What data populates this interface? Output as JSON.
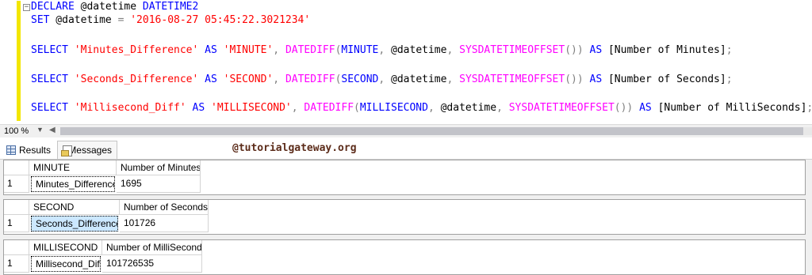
{
  "editor": {
    "collapse_glyph": "−",
    "lines": [
      [
        {
          "t": "DECLARE",
          "c": "kw"
        },
        {
          "t": " @datetime ",
          "c": "id"
        },
        {
          "t": "DATETIME2",
          "c": "dt"
        }
      ],
      [
        {
          "t": "SET",
          "c": "kw"
        },
        {
          "t": " @datetime ",
          "c": "id"
        },
        {
          "t": "=",
          "c": "op"
        },
        {
          "t": " ",
          "c": "id"
        },
        {
          "t": "'2016-08-27 05:45:22.3021234'",
          "c": "str"
        }
      ],
      [],
      [
        {
          "t": "SELECT",
          "c": "kw"
        },
        {
          "t": " ",
          "c": "id"
        },
        {
          "t": "'Minutes_Difference'",
          "c": "str"
        },
        {
          "t": " ",
          "c": "id"
        },
        {
          "t": "AS",
          "c": "kw"
        },
        {
          "t": " ",
          "c": "id"
        },
        {
          "t": "'MINUTE'",
          "c": "str"
        },
        {
          "t": ", ",
          "c": "op"
        },
        {
          "t": "DATEDIFF",
          "c": "fn"
        },
        {
          "t": "(",
          "c": "op"
        },
        {
          "t": "MINUTE",
          "c": "kw"
        },
        {
          "t": ", ",
          "c": "op"
        },
        {
          "t": "@datetime",
          "c": "id"
        },
        {
          "t": ", ",
          "c": "op"
        },
        {
          "t": "SYSDATETIMEOFFSET",
          "c": "fn"
        },
        {
          "t": "())",
          "c": "op"
        },
        {
          "t": " ",
          "c": "id"
        },
        {
          "t": "AS",
          "c": "kw"
        },
        {
          "t": " [Number of Minutes]",
          "c": "id"
        },
        {
          "t": ";",
          "c": "op"
        }
      ],
      [],
      [
        {
          "t": "SELECT",
          "c": "kw"
        },
        {
          "t": " ",
          "c": "id"
        },
        {
          "t": "'Seconds_Difference'",
          "c": "str"
        },
        {
          "t": " ",
          "c": "id"
        },
        {
          "t": "AS",
          "c": "kw"
        },
        {
          "t": " ",
          "c": "id"
        },
        {
          "t": "'SECOND'",
          "c": "str"
        },
        {
          "t": ", ",
          "c": "op"
        },
        {
          "t": "DATEDIFF",
          "c": "fn"
        },
        {
          "t": "(",
          "c": "op"
        },
        {
          "t": "SECOND",
          "c": "kw"
        },
        {
          "t": ", ",
          "c": "op"
        },
        {
          "t": "@datetime",
          "c": "id"
        },
        {
          "t": ", ",
          "c": "op"
        },
        {
          "t": "SYSDATETIMEOFFSET",
          "c": "fn"
        },
        {
          "t": "())",
          "c": "op"
        },
        {
          "t": " ",
          "c": "id"
        },
        {
          "t": "AS",
          "c": "kw"
        },
        {
          "t": " [Number of Seconds]",
          "c": "id"
        },
        {
          "t": ";",
          "c": "op"
        }
      ],
      [],
      [
        {
          "t": "SELECT",
          "c": "kw"
        },
        {
          "t": " ",
          "c": "id"
        },
        {
          "t": "'Millisecond_Diff'",
          "c": "str"
        },
        {
          "t": " ",
          "c": "id"
        },
        {
          "t": "AS",
          "c": "kw"
        },
        {
          "t": " ",
          "c": "id"
        },
        {
          "t": "'MILLISECOND'",
          "c": "str"
        },
        {
          "t": ", ",
          "c": "op"
        },
        {
          "t": "DATEDIFF",
          "c": "fn"
        },
        {
          "t": "(",
          "c": "op"
        },
        {
          "t": "MILLISECOND",
          "c": "kw"
        },
        {
          "t": ", ",
          "c": "op"
        },
        {
          "t": "@datetime",
          "c": "id"
        },
        {
          "t": ", ",
          "c": "op"
        },
        {
          "t": "SYSDATETIMEOFFSET",
          "c": "fn"
        },
        {
          "t": "())",
          "c": "op"
        },
        {
          "t": " ",
          "c": "id"
        },
        {
          "t": "AS",
          "c": "kw"
        },
        {
          "t": " [Number of MilliSeconds]",
          "c": "id"
        },
        {
          "t": ";",
          "c": "op"
        }
      ]
    ]
  },
  "zoom": {
    "value": "100 %"
  },
  "tabs": {
    "results_label": "Results",
    "messages_label": "Messages",
    "watermark": "@tutorialgateway.org"
  },
  "results": [
    {
      "headers": [
        "MINUTE",
        "Number of Minutes"
      ],
      "rows": [
        {
          "num": "1",
          "cells": [
            "Minutes_Difference",
            "1695"
          ]
        }
      ]
    },
    {
      "headers": [
        "SECOND",
        "Number of Seconds"
      ],
      "rows": [
        {
          "num": "1",
          "cells": [
            "Seconds_Difference",
            "101726"
          ]
        }
      ]
    },
    {
      "headers": [
        "MILLISECOND",
        "Number of MilliSeconds"
      ],
      "rows": [
        {
          "num": "1",
          "cells": [
            "Millisecond_Diff",
            "101726535"
          ]
        }
      ]
    }
  ]
}
